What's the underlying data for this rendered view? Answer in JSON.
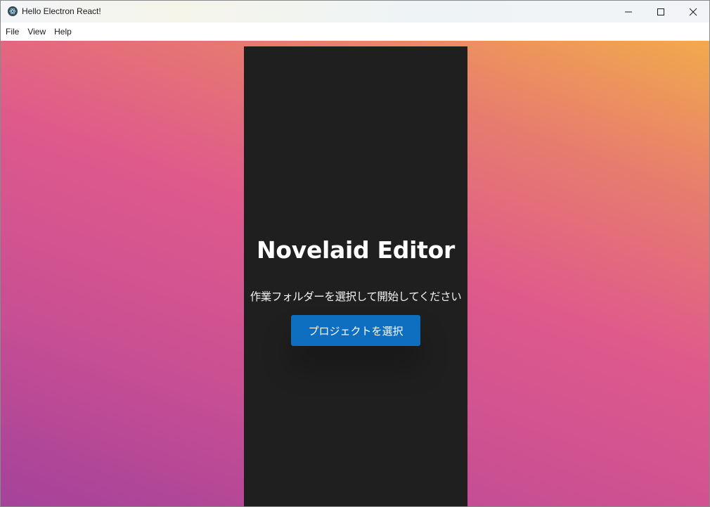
{
  "window": {
    "title": "Hello Electron React!",
    "app_icon": "electron-atom-icon",
    "controls": [
      "minimize-icon",
      "maximize-icon",
      "close-icon"
    ]
  },
  "menu": {
    "items": [
      {
        "label": "File"
      },
      {
        "label": "View"
      },
      {
        "label": "Help"
      }
    ]
  },
  "main": {
    "heading": "Novelaid Editor",
    "subtitle": "作業フォルダーを選択して開始してください",
    "select_button": "プロジェクトを選択"
  },
  "colors": {
    "panel_bg": "#1f1f1f",
    "button_bg": "#0e6ebf",
    "gradient_top_right": "#f2aa4c",
    "gradient_mid": "#df5a8b",
    "gradient_bottom_left": "#a4429a"
  }
}
